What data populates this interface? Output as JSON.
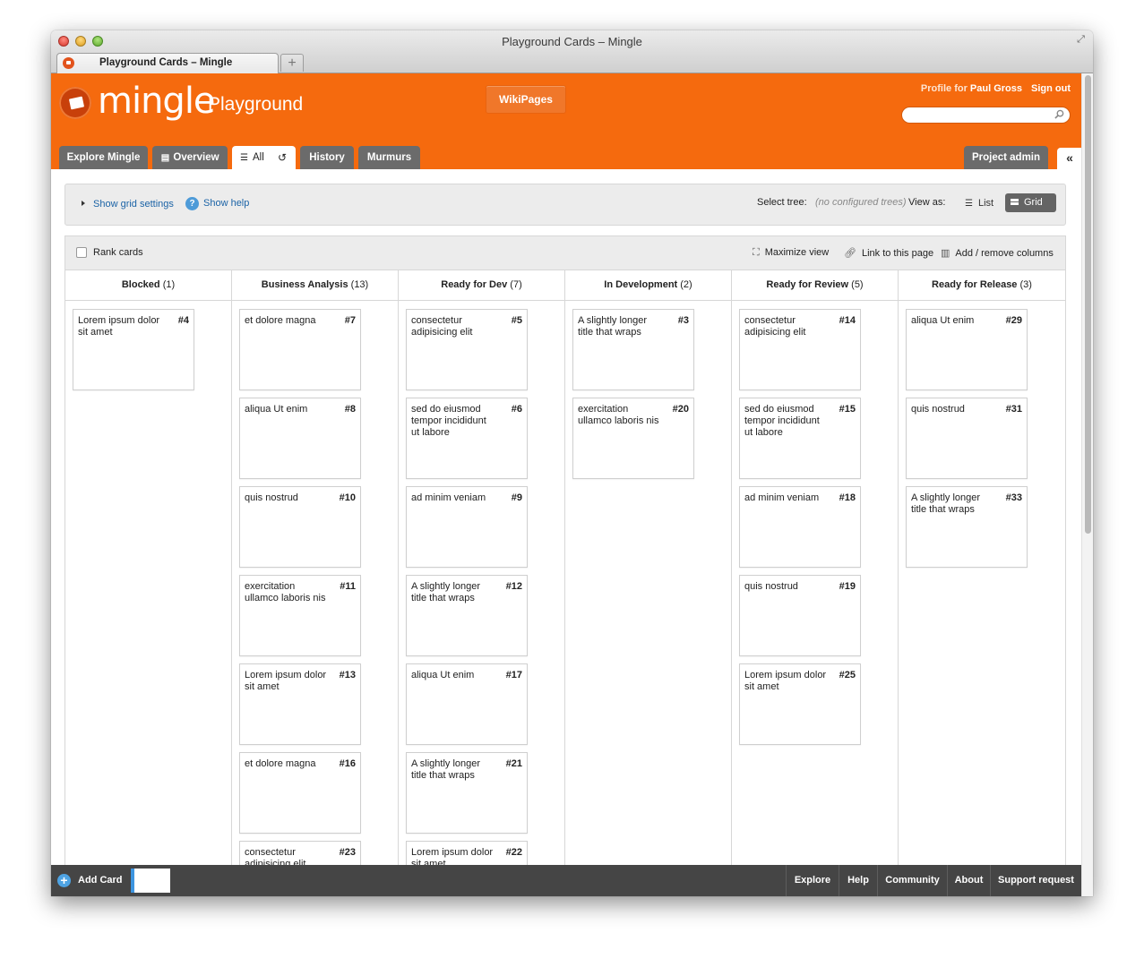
{
  "window": {
    "title": "Playground Cards – Mingle"
  },
  "browser_tab": {
    "title": "Playground Cards – Mingle",
    "new_tab": "+"
  },
  "header": {
    "logo": "mingle",
    "project": "Playground",
    "wikipages": "WikiPages",
    "profile_prefix": "Profile for ",
    "profile_name": "Paul Gross",
    "sign_out": "Sign out",
    "search_placeholder": ""
  },
  "nav_tabs": [
    "Explore Mingle",
    "Overview",
    "All",
    "History",
    "Murmurs"
  ],
  "project_admin": "Project admin",
  "collapse": "«",
  "settings": {
    "show_grid": "Show grid settings",
    "show_help": "Show help",
    "select_tree": "Select tree:",
    "no_trees": "(no configured trees)",
    "view_as": "View as:",
    "list": "List",
    "grid": "Grid"
  },
  "toolbar": {
    "rank_cards": "Rank cards",
    "maximize": "Maximize view",
    "link": "Link to this page",
    "add_remove": "Add / remove columns"
  },
  "columns": [
    {
      "name": "Blocked",
      "count": "(1)",
      "cards": [
        {
          "title": "Lorem ipsum dolor sit amet",
          "num": "#4"
        }
      ]
    },
    {
      "name": "Business Analysis",
      "count": "(13)",
      "cards": [
        {
          "title": "et dolore magna",
          "num": "#7"
        },
        {
          "title": "aliqua Ut enim",
          "num": "#8"
        },
        {
          "title": "quis nostrud",
          "num": "#10"
        },
        {
          "title": "exercitation ullamco laboris nis",
          "num": "#11"
        },
        {
          "title": "Lorem ipsum dolor sit amet",
          "num": "#13"
        },
        {
          "title": "et dolore magna",
          "num": "#16"
        },
        {
          "title": "consectetur adipisicing elit",
          "num": "#23"
        }
      ]
    },
    {
      "name": "Ready for Dev",
      "count": "(7)",
      "cards": [
        {
          "title": "consectetur adipisicing elit",
          "num": "#5"
        },
        {
          "title": "sed do eiusmod tempor incididunt ut labore",
          "num": "#6"
        },
        {
          "title": "ad minim veniam",
          "num": "#9"
        },
        {
          "title": "A slightly longer title that wraps",
          "num": "#12"
        },
        {
          "title": "aliqua Ut enim",
          "num": "#17"
        },
        {
          "title": "A slightly longer title that wraps",
          "num": "#21"
        },
        {
          "title": "Lorem ipsum dolor sit amet",
          "num": "#22"
        }
      ]
    },
    {
      "name": "In Development",
      "count": "(2)",
      "cards": [
        {
          "title": "A slightly longer title that wraps",
          "num": "#3"
        },
        {
          "title": "exercitation ullamco laboris nis",
          "num": "#20"
        }
      ]
    },
    {
      "name": "Ready for Review",
      "count": "(5)",
      "cards": [
        {
          "title": "consectetur adipisicing elit",
          "num": "#14"
        },
        {
          "title": "sed do eiusmod tempor incididunt ut labore",
          "num": "#15"
        },
        {
          "title": "ad minim veniam",
          "num": "#18"
        },
        {
          "title": "quis nostrud",
          "num": "#19"
        },
        {
          "title": "Lorem ipsum dolor sit amet",
          "num": "#25"
        }
      ]
    },
    {
      "name": "Ready for Release",
      "count": "(3)",
      "cards": [
        {
          "title": "aliqua Ut enim",
          "num": "#29"
        },
        {
          "title": "quis nostrud",
          "num": "#31"
        },
        {
          "title": "A slightly longer title that wraps",
          "num": "#33"
        }
      ]
    }
  ],
  "footer": {
    "add_card": "Add Card",
    "links": [
      "Explore",
      "Help",
      "Community",
      "About",
      "Support request"
    ]
  },
  "colors": {
    "brand": "#f56a0e",
    "tab": "#6b6b6b",
    "footer": "#454545",
    "link": "#1b63a6"
  }
}
